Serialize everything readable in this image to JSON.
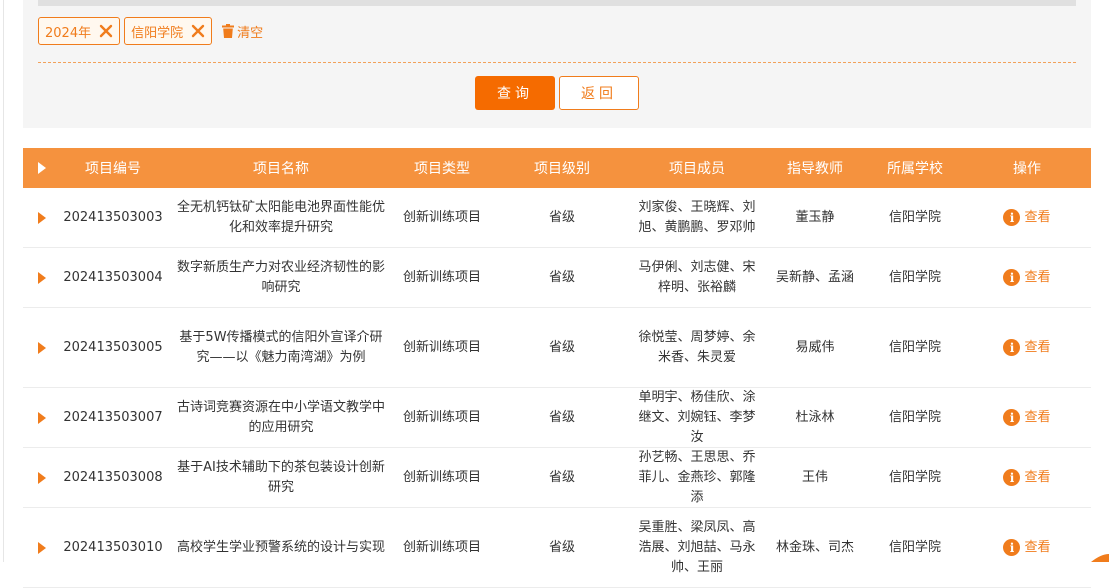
{
  "filters": {
    "tags": [
      {
        "label": "2024年"
      },
      {
        "label": "信阳学院"
      }
    ],
    "clear_label": "清空"
  },
  "buttons": {
    "query_label": "查询",
    "back_label": "返回"
  },
  "table": {
    "headers": [
      "项目编号",
      "项目名称",
      "项目类型",
      "项目级别",
      "项目成员",
      "指导教师",
      "所属学校",
      "操作"
    ],
    "rows": [
      {
        "id": "202413503003",
        "name": "全无机钙钛矿太阳能电池界面性能优化和效率提升研究",
        "type": "创新训练项目",
        "level": "省级",
        "members": "刘家俊、王晓辉、刘旭、黄鹏鹏、罗邓帅",
        "advisor": "董玉静",
        "school": "信阳学院",
        "action": "查看"
      },
      {
        "id": "202413503004",
        "name": "数字新质生产力对农业经济韧性的影响研究",
        "type": "创新训练项目",
        "level": "省级",
        "members": "马伊俐、刘志健、宋梓明、张裕麟",
        "advisor": "吴新静、孟涵",
        "school": "信阳学院",
        "action": "查看"
      },
      {
        "id": "202413503005",
        "name": "基于5W传播模式的信阳外宣译介研究——以《魅力南湾湖》为例",
        "type": "创新训练项目",
        "level": "省级",
        "members": "徐悦莹、周梦婷、余米香、朱灵爱",
        "advisor": "易威伟",
        "school": "信阳学院",
        "action": "查看"
      },
      {
        "id": "202413503007",
        "name": "古诗词竞赛资源在中小学语文教学中的应用研究",
        "type": "创新训练项目",
        "level": "省级",
        "members": "单明宇、杨佳欣、涂继文、刘婉钰、李梦汝",
        "advisor": "杜泳林",
        "school": "信阳学院",
        "action": "查看"
      },
      {
        "id": "202413503008",
        "name": "基于AI技术辅助下的茶包装设计创新研究",
        "type": "创新训练项目",
        "level": "省级",
        "members": "孙艺畅、王思思、乔菲儿、金燕珍、郭隆添",
        "advisor": "王伟",
        "school": "信阳学院",
        "action": "查看"
      },
      {
        "id": "202413503010",
        "name": "高校学生学业预警系统的设计与实现",
        "type": "创新训练项目",
        "level": "省级",
        "members": "吴重胜、梁凤凤、高浩展、刘旭喆、马永帅、王丽",
        "advisor": "林金珠、司杰",
        "school": "信阳学院",
        "action": "查看"
      }
    ]
  },
  "colors": {
    "accent": "#f07c1c",
    "header_bg": "#f5923e",
    "query_bg": "#f56b00",
    "panel_bg": "#f5f5f5"
  },
  "icons": {
    "tag_remove": "close-icon",
    "clear": "trash-icon",
    "view": "info-icon",
    "row_marker": "caret-right-icon"
  }
}
